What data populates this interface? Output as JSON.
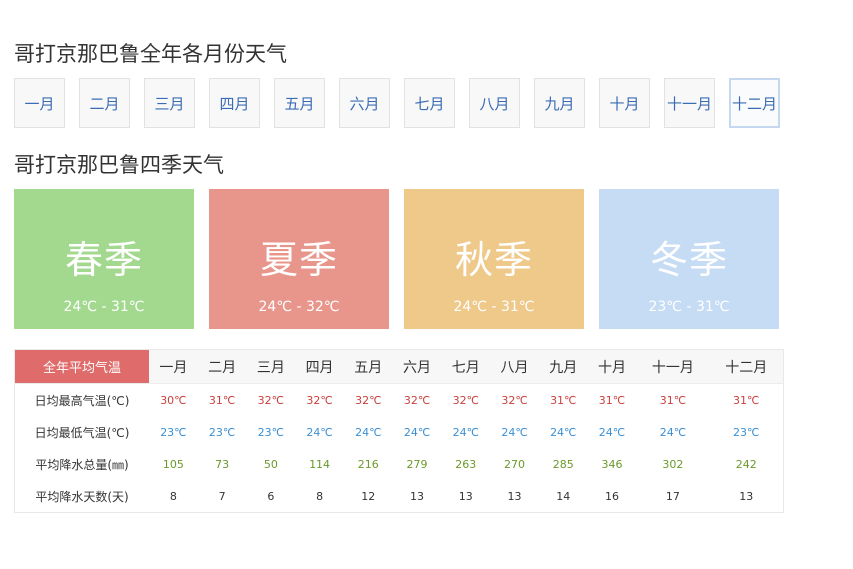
{
  "months_title": "哥打京那巴鲁全年各月份天气",
  "seasons_title": "哥打京那巴鲁四季天气",
  "months": [
    "一月",
    "二月",
    "三月",
    "四月",
    "五月",
    "六月",
    "七月",
    "八月",
    "九月",
    "十月",
    "十一月",
    "十二月"
  ],
  "active_month": "十二月",
  "seasons": [
    {
      "name": "春季",
      "range": "24℃ - 31℃",
      "color": "#a3d98f"
    },
    {
      "name": "夏季",
      "range": "24℃ - 32℃",
      "color": "#e8968b"
    },
    {
      "name": "秋季",
      "range": "24℃ - 31℃",
      "color": "#eec98a"
    },
    {
      "name": "冬季",
      "range": "23℃ - 31℃",
      "color": "#c5dcf4"
    }
  ],
  "table": {
    "corner": "全年平均气温",
    "rows": [
      {
        "label": "日均最高气温(℃)",
        "values": [
          "30℃",
          "31℃",
          "32℃",
          "32℃",
          "32℃",
          "32℃",
          "32℃",
          "32℃",
          "31℃",
          "31℃",
          "31℃",
          "31℃"
        ]
      },
      {
        "label": "日均最低气温(℃)",
        "values": [
          "23℃",
          "23℃",
          "23℃",
          "24℃",
          "24℃",
          "24℃",
          "24℃",
          "24℃",
          "24℃",
          "24℃",
          "24℃",
          "23℃"
        ]
      },
      {
        "label": "平均降水总量(㎜)",
        "values": [
          "105",
          "73",
          "50",
          "114",
          "216",
          "279",
          "263",
          "270",
          "285",
          "346",
          "302",
          "242"
        ]
      },
      {
        "label": "平均降水天数(天)",
        "values": [
          "8",
          "7",
          "6",
          "8",
          "12",
          "13",
          "13",
          "13",
          "14",
          "16",
          "17",
          "13"
        ]
      }
    ]
  }
}
